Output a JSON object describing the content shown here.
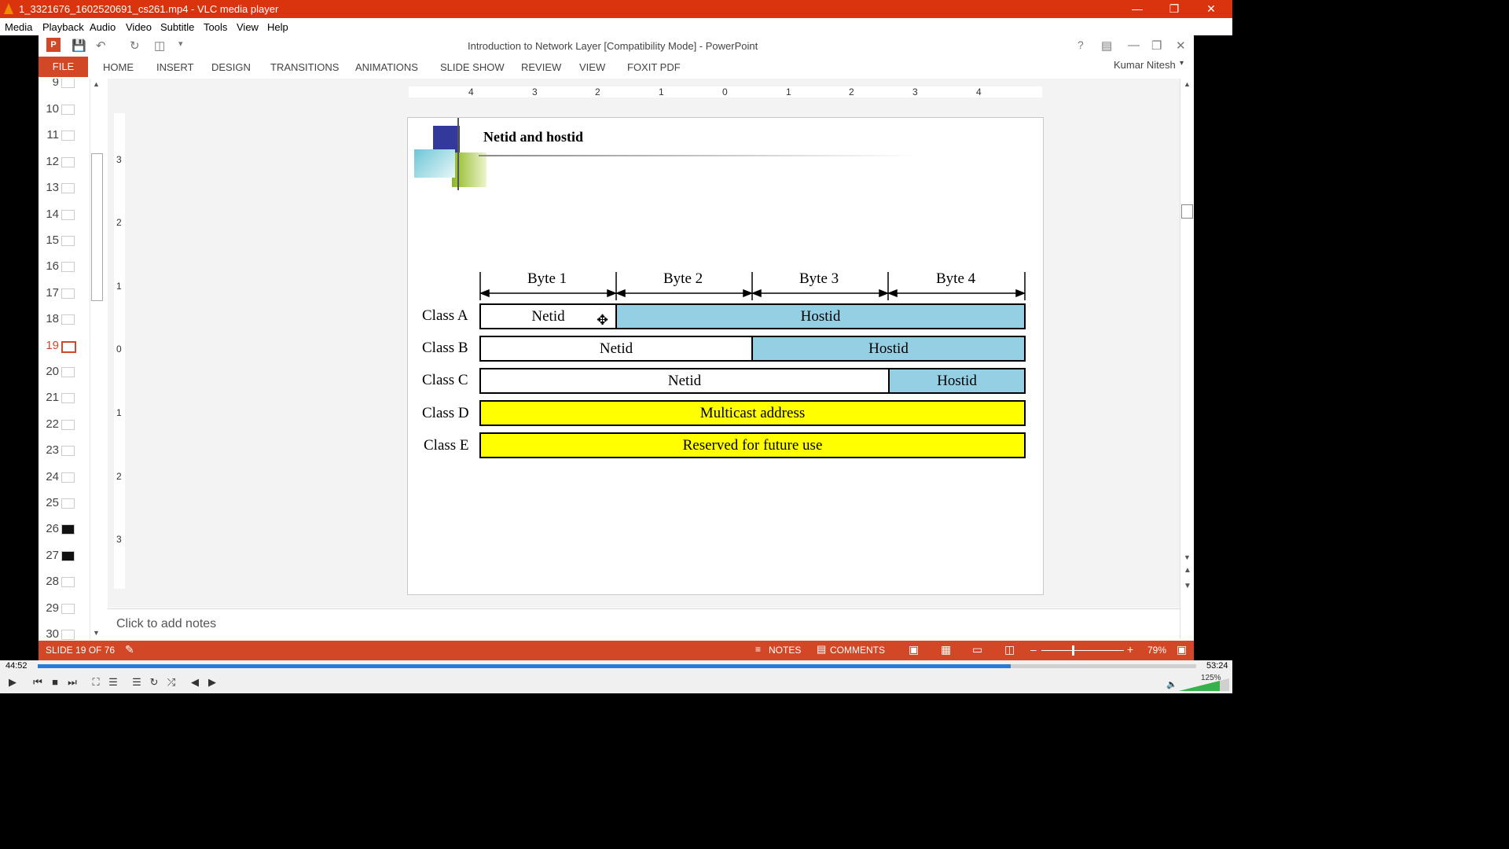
{
  "vlc": {
    "title": "1_3321676_1602520691_cs261.mp4 - VLC media player",
    "menu": [
      "Media",
      "Playback",
      "Audio",
      "Video",
      "Subtitle",
      "Tools",
      "View",
      "Help"
    ],
    "time_elapsed": "44:52",
    "time_total": "53:24",
    "progress": 0.84,
    "volume": "125%"
  },
  "ppt": {
    "doc_title": "Introduction to Network Layer [Compatibility Mode] - PowerPoint",
    "tabs": [
      "FILE",
      "HOME",
      "INSERT",
      "DESIGN",
      "TRANSITIONS",
      "ANIMATIONS",
      "SLIDE SHOW",
      "REVIEW",
      "VIEW",
      "FOXIT PDF"
    ],
    "user": "Kumar Nitesh",
    "help": "?",
    "thumbnails": [
      "9",
      "10",
      "11",
      "12",
      "13",
      "14",
      "15",
      "16",
      "17",
      "18",
      "19",
      "20",
      "21",
      "22",
      "23",
      "24",
      "25",
      "26",
      "27",
      "28",
      "29",
      "30"
    ],
    "current_slide": "19",
    "ruler_h": [
      "4",
      "3",
      "2",
      "1",
      "0",
      "1",
      "2",
      "3",
      "4"
    ],
    "ruler_v": [
      "3",
      "2",
      "1",
      "0",
      "1",
      "2",
      "3"
    ],
    "notes_placeholder": "Click to add notes",
    "status": {
      "slide_info": "SLIDE 19 OF 76",
      "notes": "NOTES",
      "comments": "COMMENTS",
      "zoom": "79%"
    }
  },
  "slide": {
    "title": "Netid and hostid",
    "bytes": [
      "Byte 1",
      "Byte 2",
      "Byte 3",
      "Byte 4"
    ],
    "rows": [
      {
        "label": "Class A",
        "segments": [
          {
            "text": "Netid"
          },
          {
            "text": "Hostid"
          }
        ]
      },
      {
        "label": "Class B",
        "segments": [
          {
            "text": "Netid"
          },
          {
            "text": "Hostid"
          }
        ]
      },
      {
        "label": "Class C",
        "segments": [
          {
            "text": "Netid"
          },
          {
            "text": "Hostid"
          }
        ]
      },
      {
        "label": "Class D",
        "segments": [
          {
            "text": "Multicast address"
          }
        ]
      },
      {
        "label": "Class E",
        "segments": [
          {
            "text": "Reserved for future use"
          }
        ]
      }
    ],
    "colors": {
      "hostid": "#94cfe4",
      "netid": "#ffffff",
      "special": "#ffff00"
    }
  },
  "colors": {
    "vlc_orange": "#d9340e",
    "ppt_accent": "#d24726",
    "progress": "#2b7bd6"
  }
}
